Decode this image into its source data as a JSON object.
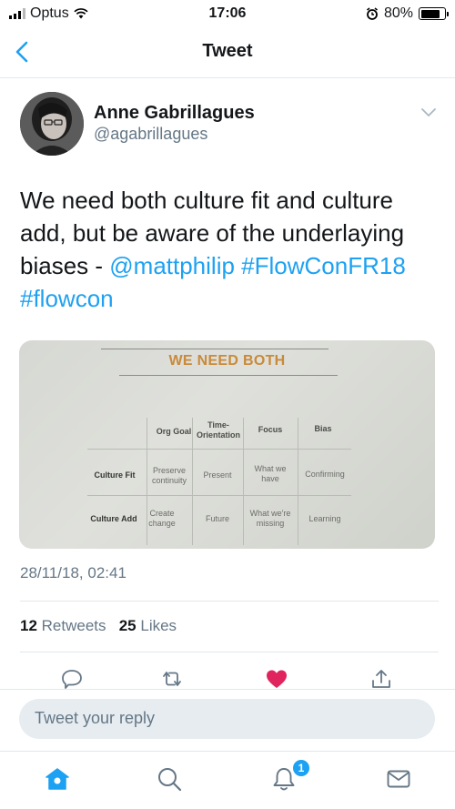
{
  "status_bar": {
    "carrier": "Optus",
    "time": "17:06",
    "battery": "80%",
    "battery_level": 0.8
  },
  "nav": {
    "title": "Tweet"
  },
  "tweet": {
    "author_name": "Anne Gabrillagues",
    "author_handle": "@agabrillagues",
    "text_parts": {
      "t1": "We need both culture fit and culture add, but be aware of the underlaying biases - ",
      "mention": "@mattphilip",
      "hashtag1": "#FlowConFR18",
      "hashtag2": "#flowcon"
    },
    "timestamp": "28/11/18, 02:41",
    "retweets_count": "12",
    "retweets_label": "Retweets",
    "likes_count": "25",
    "likes_label": "Likes"
  },
  "slide": {
    "title": "WE NEED BOTH",
    "columns": [
      "Org Goal",
      "Time-\nOrientation",
      "Focus",
      "Bias"
    ],
    "rows": [
      {
        "label": "Culture Fit",
        "cells": [
          "Preserve\ncontinuity",
          "Present",
          "What we\nhave",
          "Confirming"
        ]
      },
      {
        "label": "Culture Add",
        "cells": [
          "Create\nchange",
          "Future",
          "What we're\nmissing",
          "Learning"
        ]
      }
    ]
  },
  "reply": {
    "placeholder": "Tweet your reply"
  },
  "tab_bar": {
    "notifications_badge": "1"
  },
  "colors": {
    "accent": "#1da1f2",
    "like": "#e0245e",
    "secondary_text": "#657786"
  }
}
